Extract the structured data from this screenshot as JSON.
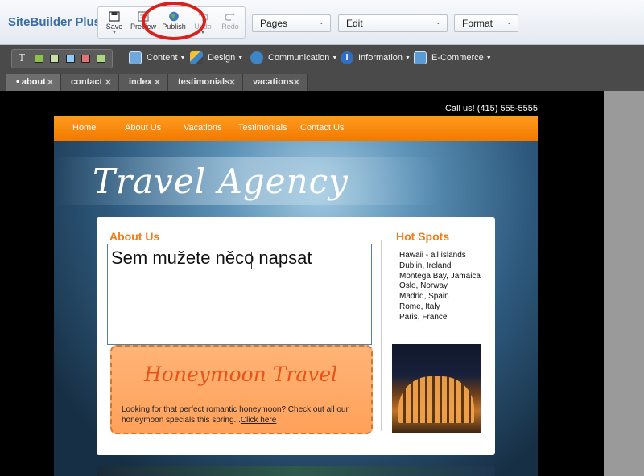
{
  "app": {
    "title": "SiteBuilder Plus"
  },
  "toolbar": {
    "buttons": [
      {
        "label": "Save",
        "icon": "save-icon",
        "enabled": true,
        "has_menu": true
      },
      {
        "label": "Preview",
        "icon": "preview-icon",
        "enabled": true,
        "has_menu": false
      },
      {
        "label": "Publish",
        "icon": "globe-icon",
        "enabled": true,
        "has_menu": false
      },
      {
        "label": "Undo",
        "icon": "undo-icon",
        "enabled": false,
        "has_menu": true
      },
      {
        "label": "Redo",
        "icon": "redo-icon",
        "enabled": false,
        "has_menu": false
      }
    ],
    "highlight_color": "#d8201d",
    "dropdowns": [
      {
        "label": "Pages"
      },
      {
        "label": "Edit"
      },
      {
        "label": "Format"
      }
    ]
  },
  "menubar": {
    "insert_icons": [
      "text-icon",
      "image-icon",
      "photo-gallery-icon",
      "table-icon",
      "video-icon",
      "widget-icon"
    ],
    "menus": [
      {
        "label": "Content",
        "icon": "content-icon"
      },
      {
        "label": "Design",
        "icon": "pencil-icon"
      },
      {
        "label": "Communication",
        "icon": "communication-icon"
      },
      {
        "label": "Information",
        "icon": "info-icon"
      },
      {
        "label": "E-Commerce",
        "icon": "ecommerce-icon"
      }
    ]
  },
  "tabs": [
    {
      "label": "• about",
      "active": true
    },
    {
      "label": "contact",
      "active": false
    },
    {
      "label": "index",
      "active": false
    },
    {
      "label": "testimonials",
      "active": false
    },
    {
      "label": "vacations",
      "active": false
    }
  ],
  "site": {
    "call_us": "Call us! (415) 555-5555",
    "nav": [
      "Home",
      "About Us",
      "Vacations",
      "Testimonials",
      "Contact Us"
    ],
    "header_title": "Travel Agency",
    "about": {
      "title": "About Us",
      "editor_text": "Sem mužete něco napsat"
    },
    "promo": {
      "title": "Honeymoon Travel",
      "text": "Looking for that perfect romantic honeymoon? Check out all our honeymoon specials this spring...",
      "link": "Click here"
    },
    "hot_spots": {
      "title": "Hot Spots",
      "items": [
        "Hawaii - all islands",
        "Dublin, Ireland",
        "Montega Bay, Jamaica",
        "Oslo, Norway",
        "Madrid, Spain",
        "Rome, Italy",
        "Paris, France"
      ]
    },
    "colors": {
      "accent": "#ee7d1a",
      "nav": "#f27a00",
      "brand": "#3a6ea5"
    }
  }
}
